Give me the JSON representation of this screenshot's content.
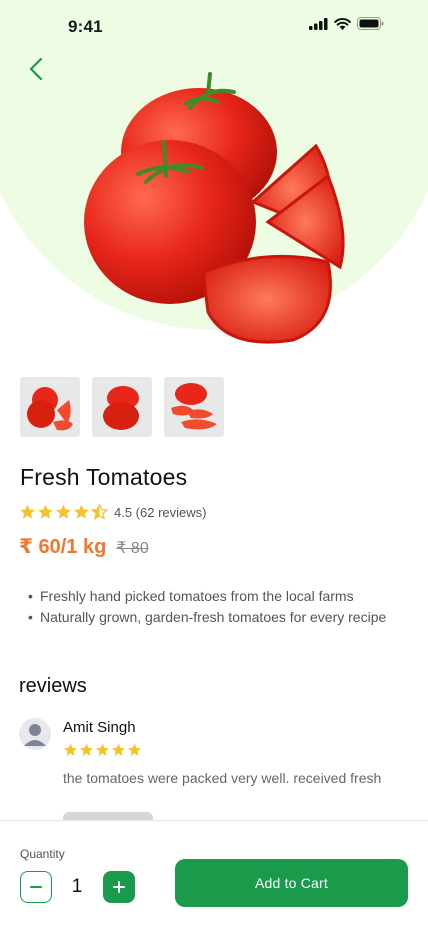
{
  "status_bar": {
    "time": "9:41"
  },
  "colors": {
    "accent_green": "#1a9a4b",
    "price_orange": "#f3762f",
    "hero_bg": "#eefce3",
    "star_yellow": "#f6c32a"
  },
  "product": {
    "title": "Fresh Tomatoes",
    "rating": 4.5,
    "rating_text": "4.5 (62 reviews)",
    "price": "₹ 60/1 kg",
    "old_price": "₹ 80",
    "thumbnails": [
      "tomato-thumb-1",
      "tomato-thumb-2",
      "tomato-thumb-3"
    ],
    "features": [
      "Freshly hand picked tomatoes from the local farms",
      "Naturally grown, garden-fresh tomatoes for every recipe"
    ]
  },
  "reviews": {
    "title": "reviews",
    "items": [
      {
        "name": "Amit Singh",
        "stars": 5,
        "text": "the tomatoes were packed very well. received fresh"
      }
    ]
  },
  "cart": {
    "quantity_label": "Quantity",
    "quantity": "1",
    "add_label": "Add to Cart"
  },
  "icons": [
    "back-chevron-icon",
    "signal-icon",
    "wifi-icon",
    "battery-icon",
    "star-icon",
    "user-icon",
    "minus-icon",
    "plus-icon"
  ]
}
